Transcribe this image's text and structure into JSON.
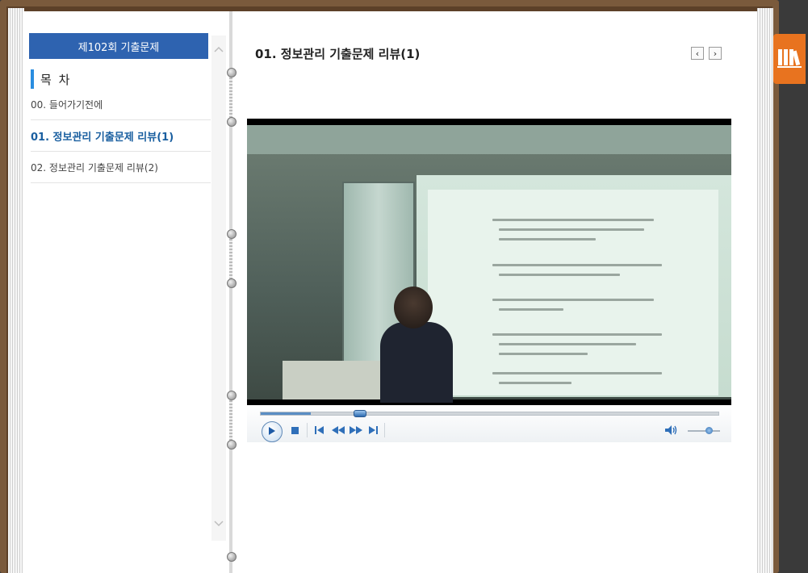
{
  "toc": {
    "header": "제102회 기출문제",
    "title": "목 차",
    "items": [
      {
        "label": "00. 들어가기전에",
        "active": false
      },
      {
        "label": "01. 정보관리 기출문제 리뷰(1)",
        "active": true
      },
      {
        "label": "02. 정보관리 기출문제 리뷰(2)",
        "active": false
      }
    ]
  },
  "lesson": {
    "title": "01. 정보관리 기출문제 리뷰(1)",
    "prev_symbol": "‹",
    "next_symbol": "›"
  },
  "player": {
    "progress_fraction": 0.11,
    "volume_fraction": 0.55,
    "play_icon": "play-icon",
    "stop_icon": "stop-icon",
    "prev_icon": "skip-previous-icon",
    "rewind_icon": "rewind-icon",
    "forward_icon": "fast-forward-icon",
    "next_icon": "skip-next-icon",
    "volume_icon": "speaker-icon"
  },
  "colors": {
    "toc_header_bg": "#2e63b0",
    "toc_active": "#1a5fa0",
    "library_tab": "#e8731f"
  }
}
